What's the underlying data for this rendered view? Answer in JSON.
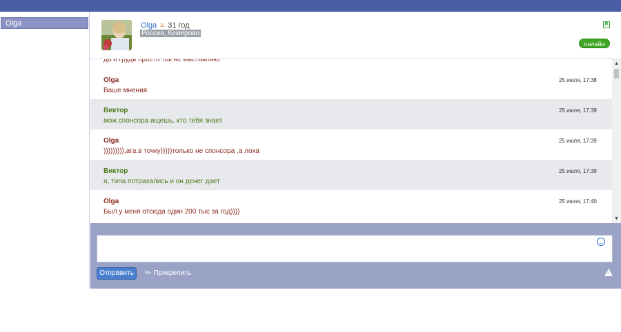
{
  "sidebar": {
    "contact_name": "Olga"
  },
  "profile": {
    "name": "Olga",
    "age": "31 год",
    "location": "Россия, Кемерово",
    "status": "онлайн",
    "badge": "R"
  },
  "chat": {
    "partial_text": "да и грудь просто так не выставляю,",
    "messages": [
      {
        "author": "Olga",
        "time": "25 июля, 17:38",
        "text": "Ваше мнения."
      },
      {
        "author": "Виктор",
        "time": "25 июля, 17:39",
        "text": "мож спонсора ищешь, кто тебя знает"
      },
      {
        "author": "Olga",
        "time": "25 июля, 17:39",
        "text": "))))))))),ага.в точку)))))только не спонсора ,а лоха"
      },
      {
        "author": "Виктор",
        "time": "25 июля, 17:39",
        "text": "а, типа потрахались и он денег дает"
      },
      {
        "author": "Olga",
        "time": "25 июля, 17:40",
        "text": "Был у меня отсюда один 200 тыс за год))))"
      }
    ]
  },
  "composer": {
    "send_label": "Отправить",
    "attach_label": "Прикрепить",
    "icons": {
      "smiley": "smiley-icon",
      "attach": "paperclip-icon",
      "warning": "warning-icon"
    }
  },
  "colors": {
    "topbar": "#4a5ea8",
    "olga": "#8b2b20",
    "viktor": "#4d7a1e",
    "online": "#3fa524",
    "send": "#4a7fd0"
  }
}
